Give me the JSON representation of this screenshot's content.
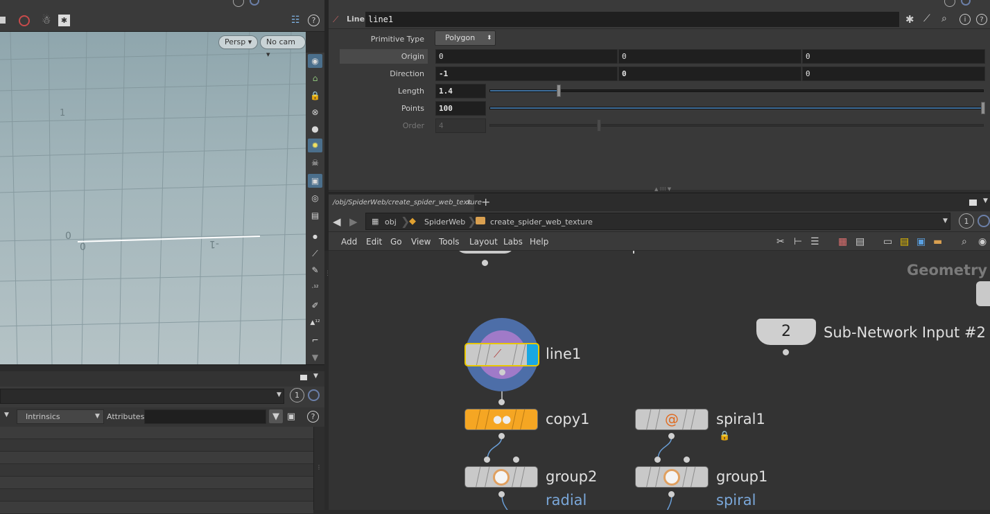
{
  "viewport": {
    "persp_label": "Persp",
    "cam_label": "No cam",
    "grid_label_zero_a": "0",
    "grid_label_zero_b": "0",
    "grid_label_minus1": "-1",
    "grid_label_1": "1"
  },
  "spreadsheet": {
    "intrinsics_label": "Intrinsics",
    "attributes_label": "Attributes:",
    "count": "1"
  },
  "params": {
    "node_type": "Line",
    "node_name": "line1",
    "rows": {
      "primitive_type": {
        "label": "Primitive Type",
        "value": "Polygon"
      },
      "origin": {
        "label": "Origin",
        "values": [
          "0",
          "0",
          "0"
        ]
      },
      "direction": {
        "label": "Direction",
        "values": [
          "-1",
          "0",
          "0"
        ]
      },
      "length": {
        "label": "Length",
        "value": "1.4"
      },
      "points": {
        "label": "Points",
        "value": "100"
      },
      "order": {
        "label": "Order",
        "value": "4"
      }
    }
  },
  "network": {
    "tab_label": "/obj/SpiderWeb/create_spider_web_texture",
    "tab_close": "×",
    "tab_add": "+",
    "path": [
      "obj",
      "SpiderWeb",
      "create_spider_web_texture"
    ],
    "count": "1",
    "menu": [
      "Add",
      "Edit",
      "Go",
      "View",
      "Tools",
      "Layout",
      "Labs",
      "Help"
    ],
    "context_label": "Geometry",
    "subnet_input_number": "2",
    "subnet_input_label": "Sub-Network Input #2",
    "nodes": {
      "line1": "line1",
      "copy1": "copy1",
      "spiral1": "spiral1",
      "group2": "group2",
      "group1": "group1",
      "group2_sub": "radial",
      "group1_sub": "spiral"
    }
  },
  "colors": {
    "copy_node": "#f5a623",
    "selected_outline": "#e8c700",
    "display_flag": "#19a7e3",
    "subtext_blue": "#7aa7d9",
    "spiral_orange": "#e06a1f"
  }
}
